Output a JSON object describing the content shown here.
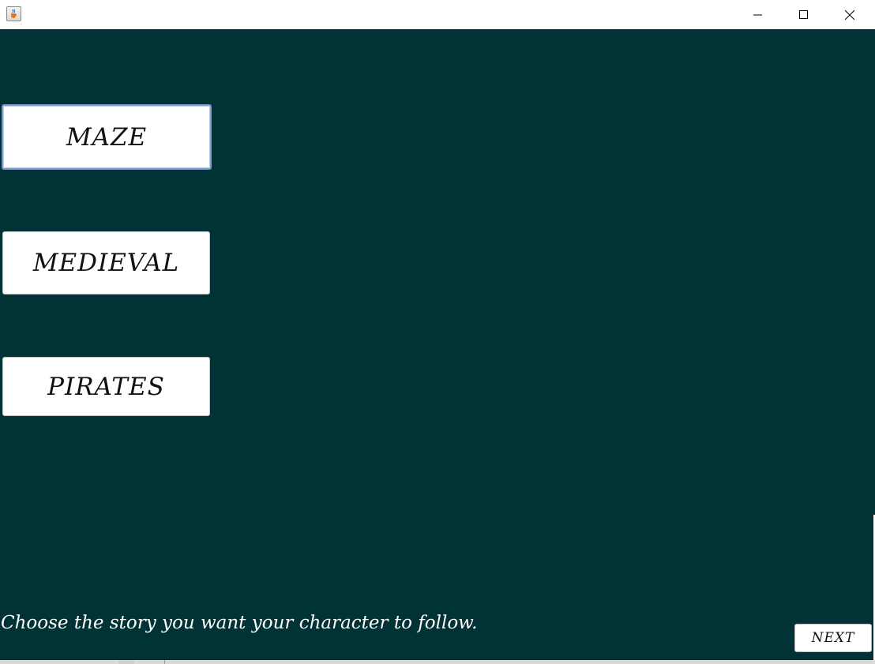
{
  "window": {
    "icon": "java-cup-icon",
    "controls": {
      "minimize": "minimize-icon",
      "maximize": "maximize-icon",
      "close": "close-icon"
    }
  },
  "colors": {
    "background": "#003236",
    "button_bg": "#ffffff",
    "focus_border": "#7a9cc6",
    "instruction_text": "#ffffff"
  },
  "stories": {
    "maze": "MAZE",
    "medieval": "MEDIEVAL",
    "pirates": "PIRATES"
  },
  "instruction": "Choose the story you want your character to follow.",
  "next_label": "NEXT"
}
